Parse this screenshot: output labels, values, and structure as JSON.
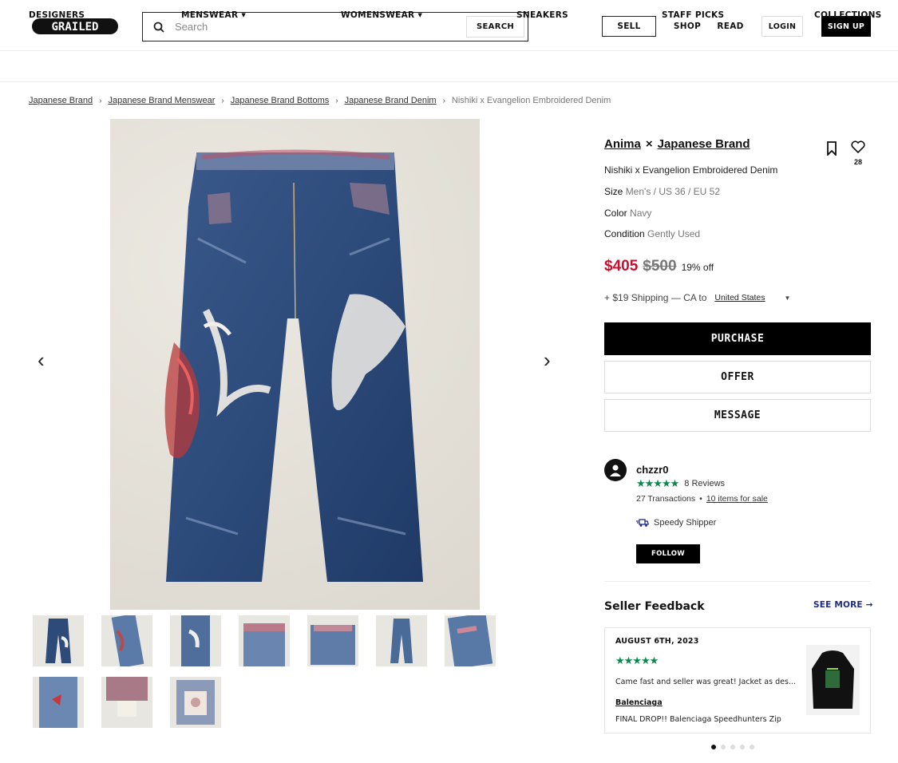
{
  "header": {
    "logo_text": "GRAILED",
    "search": {
      "placeholder": "Search",
      "button": "SEARCH"
    },
    "sell": "SELL",
    "shop": "SHOP",
    "read": "READ",
    "login": "LOGIN",
    "signup": "SIGN UP"
  },
  "nav": {
    "designers": "DESIGNERS",
    "menswear": "MENSWEAR",
    "womenswear": "WOMENSWEAR",
    "sneakers": "SNEAKERS",
    "staff_picks": "STAFF PICKS",
    "collections": "COLLECTIONS"
  },
  "breadcrumbs": {
    "c1": "Japanese Brand",
    "c2": "Japanese Brand Menswear",
    "c3": "Japanese Brand Bottoms",
    "c4": "Japanese Brand Denim",
    "current": "Nishiki x Evangelion Embroidered Denim"
  },
  "product": {
    "designer_a": "Anima",
    "designer_sep": "×",
    "designer_b": "Japanese Brand",
    "favorites": "28",
    "title": "Nishiki x Evangelion Embroidered Denim",
    "size_label": "Size",
    "size_value": "Men's / US 36 / EU 52",
    "color_label": "Color",
    "color_value": "Navy",
    "condition_label": "Condition",
    "condition_value": "Gently Used",
    "price_now": "$405",
    "price_was": "$500",
    "discount": "19% off",
    "shipping": "+ $19 Shipping — CA to",
    "ship_country": "United States",
    "purchase": "PURCHASE",
    "offer": "OFFER",
    "message": "MESSAGE"
  },
  "seller": {
    "name": "chzzr0",
    "stars": "★★★★★",
    "reviews": "8 Reviews",
    "transactions": "27 Transactions",
    "bullet": "•",
    "items_for_sale": "10 items for sale",
    "badge": "Speedy Shipper",
    "follow": "FOLLOW"
  },
  "feedback": {
    "title": "Seller Feedback",
    "see_more": "SEE MORE →",
    "date": "AUGUST 6TH, 2023",
    "stars": "★★★★★",
    "text": "Came fast and seller was great! Jacket as des...",
    "brand": "Balenciaga",
    "item": "FINAL DROP!! Balenciaga Speedhunters Zip"
  },
  "colors": {
    "accent_price": "#c8102e",
    "stars_green": "#0a8a4a",
    "link_blue": "#1e2a8a",
    "denim": "#2e4a78"
  }
}
